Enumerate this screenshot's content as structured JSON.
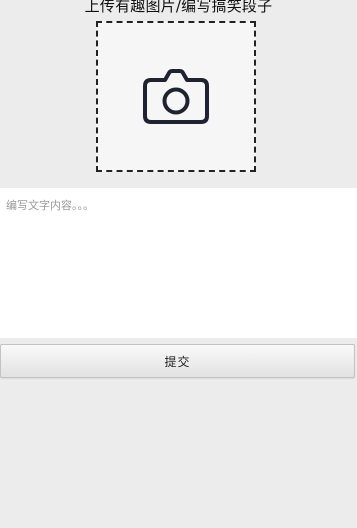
{
  "header": {
    "title": "上传有趣图片/编写搞笑段子"
  },
  "upload": {
    "icon": "camera-icon"
  },
  "editor": {
    "placeholder": "编写文字内容。。。",
    "value": ""
  },
  "actions": {
    "submit_label": "提交"
  }
}
